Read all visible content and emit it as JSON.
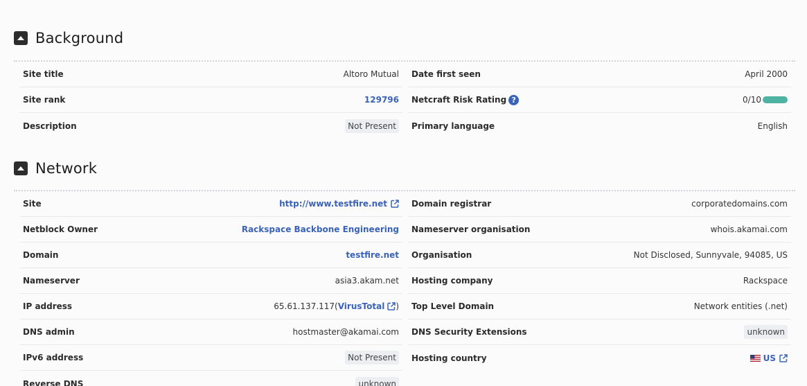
{
  "background": {
    "title": "Background",
    "left": [
      {
        "label": "Site title",
        "value": "Altoro Mutual"
      },
      {
        "label": "Site rank",
        "value": "129796"
      },
      {
        "label": "Description",
        "value": "Not Present"
      }
    ],
    "right": [
      {
        "label": "Date first seen",
        "value": "April 2000"
      },
      {
        "label": "Netcraft Risk Rating",
        "value": "0/10",
        "help": "?",
        "risk_color": "#4fb3a3"
      },
      {
        "label": "Primary language",
        "value": "English"
      }
    ]
  },
  "network": {
    "title": "Network",
    "left": [
      {
        "label": "Site",
        "value": "http://www.testfire.net"
      },
      {
        "label": "Netblock Owner",
        "value": "Rackspace Backbone Engineering"
      },
      {
        "label": "Domain",
        "value": "testfire.net"
      },
      {
        "label": "Nameserver",
        "value": "asia3.akam.net"
      },
      {
        "label": "IP address",
        "value": "65.61.137.117",
        "open": " (",
        "link": "VirusTotal",
        "close": ")"
      },
      {
        "label": "DNS admin",
        "value": "hostmaster@akamai.com"
      },
      {
        "label": "IPv6 address",
        "value": "Not Present"
      },
      {
        "label": "Reverse DNS",
        "value": "unknown"
      }
    ],
    "right": [
      {
        "label": "Domain registrar",
        "value": "corporatedomains.com"
      },
      {
        "label": "Nameserver organisation",
        "value": "whois.akamai.com"
      },
      {
        "label": "Organisation",
        "value": "Not Disclosed, Sunnyvale, 94085, US"
      },
      {
        "label": "Hosting company",
        "value": "Rackspace"
      },
      {
        "label": "Top Level Domain",
        "value": "Network entities (.net)"
      },
      {
        "label": "DNS Security Extensions",
        "value": "unknown"
      },
      {
        "label": "Hosting country",
        "value": "US"
      }
    ]
  },
  "colors": {
    "link": "#3a63b8",
    "accent_bar": "#4fb3a3",
    "header_icon_bg": "#2d2d2d"
  },
  "icons": {
    "section_toggle": "caret-up-icon",
    "external_link": "external-link-icon",
    "help": "help-icon",
    "flag": "us-flag-icon"
  }
}
